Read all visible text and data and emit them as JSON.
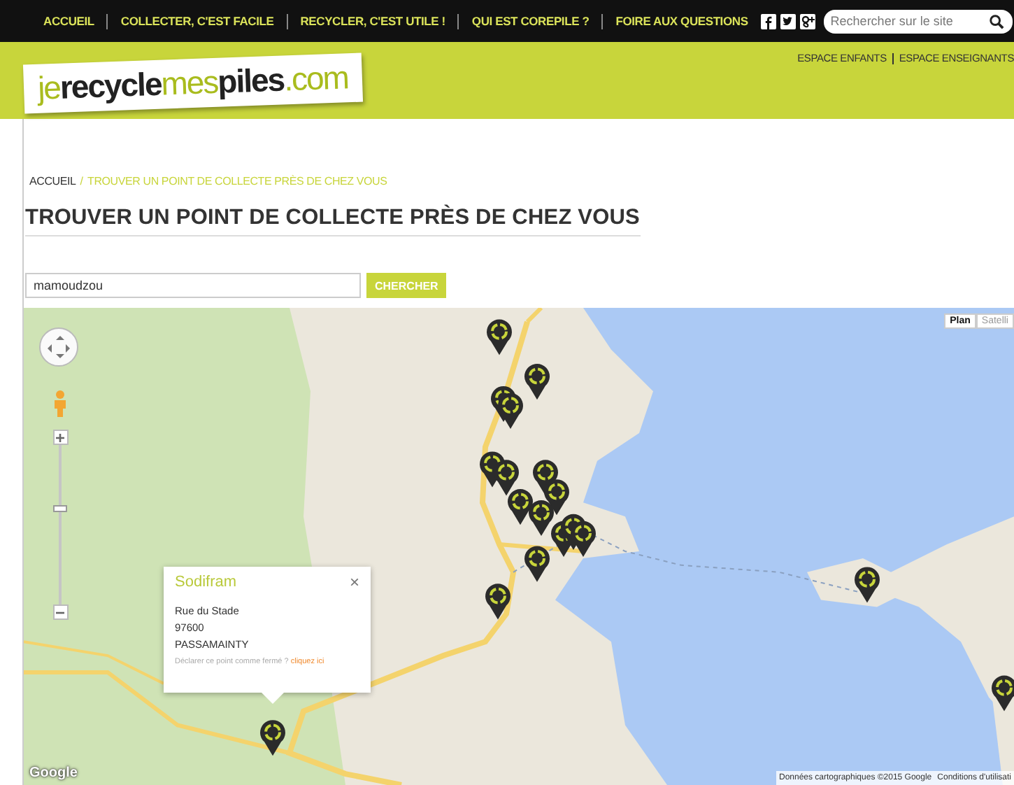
{
  "top_nav": {
    "items": [
      "ACCUEIL",
      "COLLECTER, C'EST FACILE",
      "RECYCLER, C'EST UTILE !",
      "QUI EST COREPILE ?",
      "FOIRE AUX QUESTIONS"
    ],
    "search": {
      "placeholder": "Rechercher sur le site"
    }
  },
  "header": {
    "logo": [
      {
        "text": "je",
        "accent": true
      },
      {
        "text": "recycle",
        "accent": false
      },
      {
        "text": "mes",
        "accent": true
      },
      {
        "text": "piles",
        "accent": false
      },
      {
        "text": ".com",
        "accent": true
      }
    ],
    "links": [
      "ESPACE ENFANTS",
      "ESPACE ENSEIGNANTS"
    ]
  },
  "breadcrumb_separator": "/",
  "breadcrumb": [
    {
      "label": "ACCUEIL",
      "selected": false
    },
    {
      "label": "TROUVER UN POINT DE COLLECTE PRÈS DE CHEZ VOUS",
      "selected": true
    }
  ],
  "title": "TROUVER UN POINT DE COLLECTE PRÈS DE CHEZ VOUS",
  "search": {
    "value": "mamoudzou",
    "button": "CHERCHER"
  },
  "map": {
    "zoom": {
      "level": 0.6
    },
    "map_types": [
      {
        "label": "Plan",
        "selected": true
      },
      {
        "label": "Satelli",
        "selected": false
      }
    ],
    "popup": {
      "title": "Sodifram",
      "lines": [
        "Rue du Stade",
        "97600",
        "PASSAMAINTY"
      ],
      "note": "Déclarer ce point comme fermé ?",
      "link": "cliquez ici",
      "close": "×"
    },
    "logo": "Google",
    "attribution": [
      "Données cartographiques ©2015 Google",
      "Conditions d'utilisati"
    ]
  }
}
